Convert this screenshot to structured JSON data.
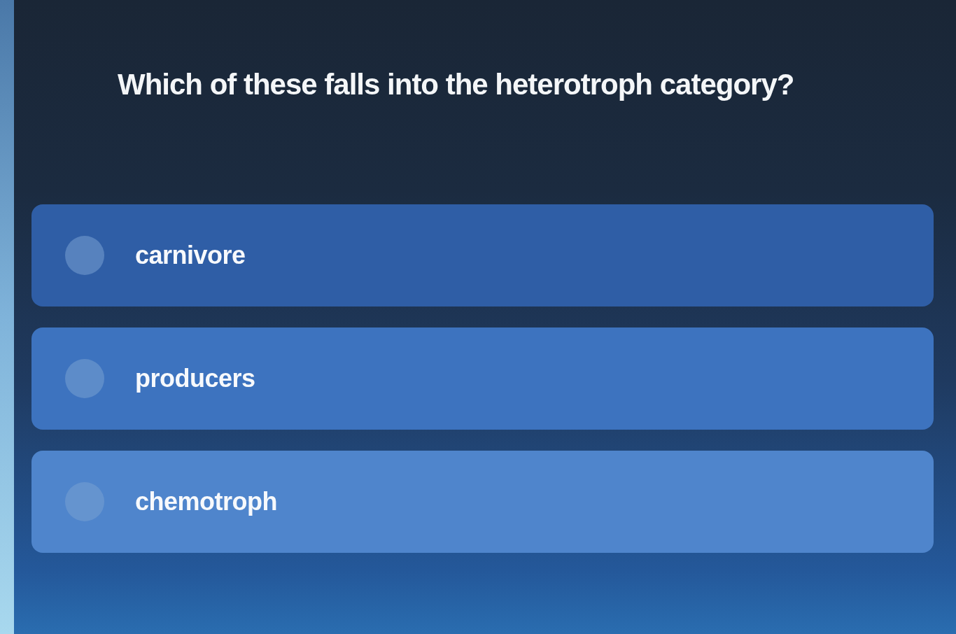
{
  "question": "Which of these falls into the heterotroph category?",
  "options": [
    {
      "label": "carnivore",
      "selected": false
    },
    {
      "label": "producers",
      "selected": false
    },
    {
      "label": "chemotroph",
      "selected": false
    }
  ]
}
